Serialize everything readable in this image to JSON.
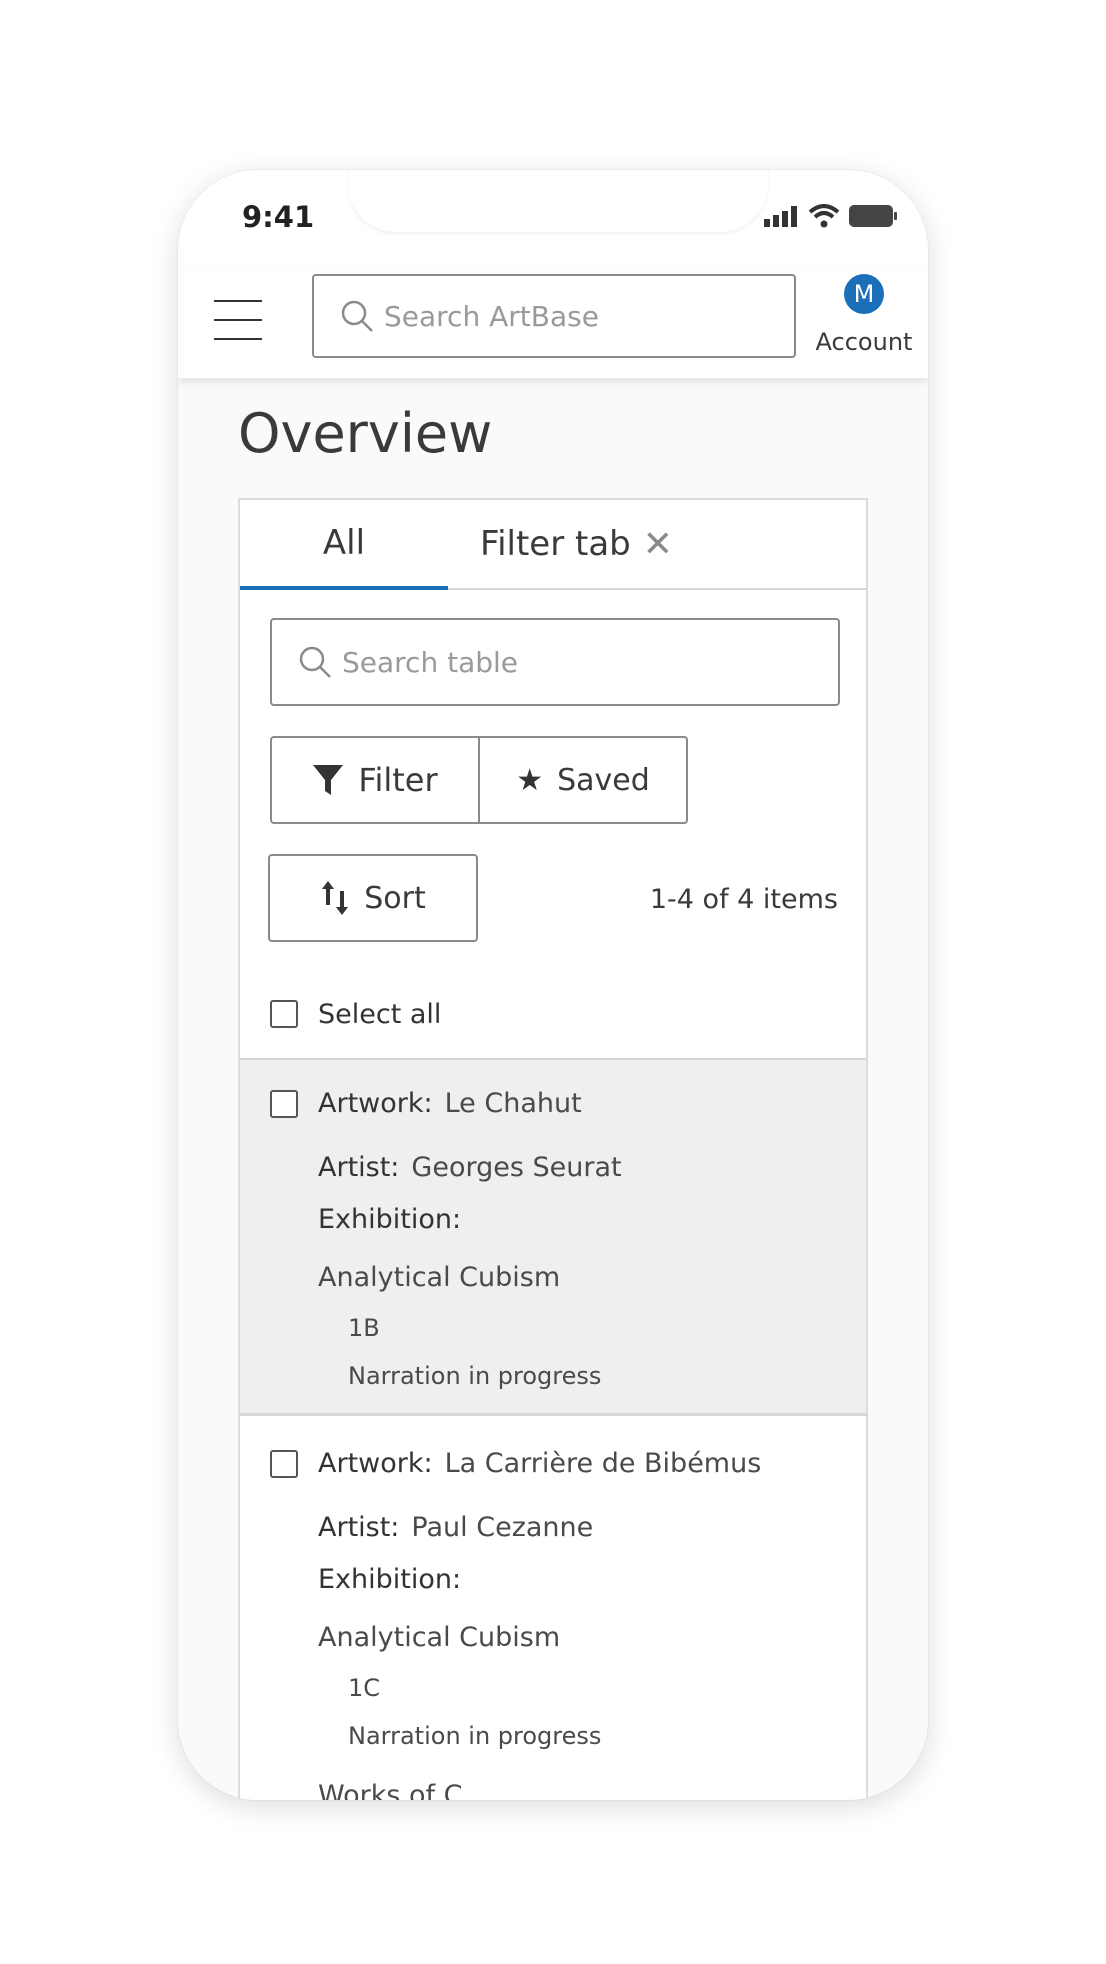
{
  "status": {
    "time": "9:41"
  },
  "header": {
    "search_placeholder": "Search ArtBase",
    "account_initial": "M",
    "account_label": "Account"
  },
  "page": {
    "title": "Overview"
  },
  "tabs": [
    {
      "label": "All"
    },
    {
      "label": "Filter tab"
    }
  ],
  "table": {
    "search_placeholder": "Search table",
    "filter_label": "Filter",
    "saved_label": "Saved",
    "sort_label": "Sort",
    "item_count": "1-4 of 4 items",
    "select_all_label": "Select all",
    "field_labels": {
      "artwork": "Artwork:",
      "artist": "Artist:",
      "exhibition": "Exhibition:"
    },
    "items": [
      {
        "artwork": "Le Chahut",
        "artist": "Georges Seurat",
        "exhibition": "Analytical Cubism",
        "code": "1B",
        "status": "Narration in progress"
      },
      {
        "artwork": "La Carrière de Bibémus",
        "artist": "Paul Cezanne",
        "exhibition": "Analytical Cubism",
        "code": "1C",
        "status": "Narration in progress"
      }
    ],
    "cut_off_text": "Works of C..."
  },
  "colors": {
    "accent": "#1a6fb8",
    "selected_row": "#efefef"
  },
  "icons": [
    "signal-icon",
    "wifi-icon",
    "battery-icon",
    "hamburger-icon",
    "search-icon",
    "close-icon",
    "filter-funnel-icon",
    "star-icon",
    "sort-arrows-icon",
    "checkbox-icon"
  ]
}
